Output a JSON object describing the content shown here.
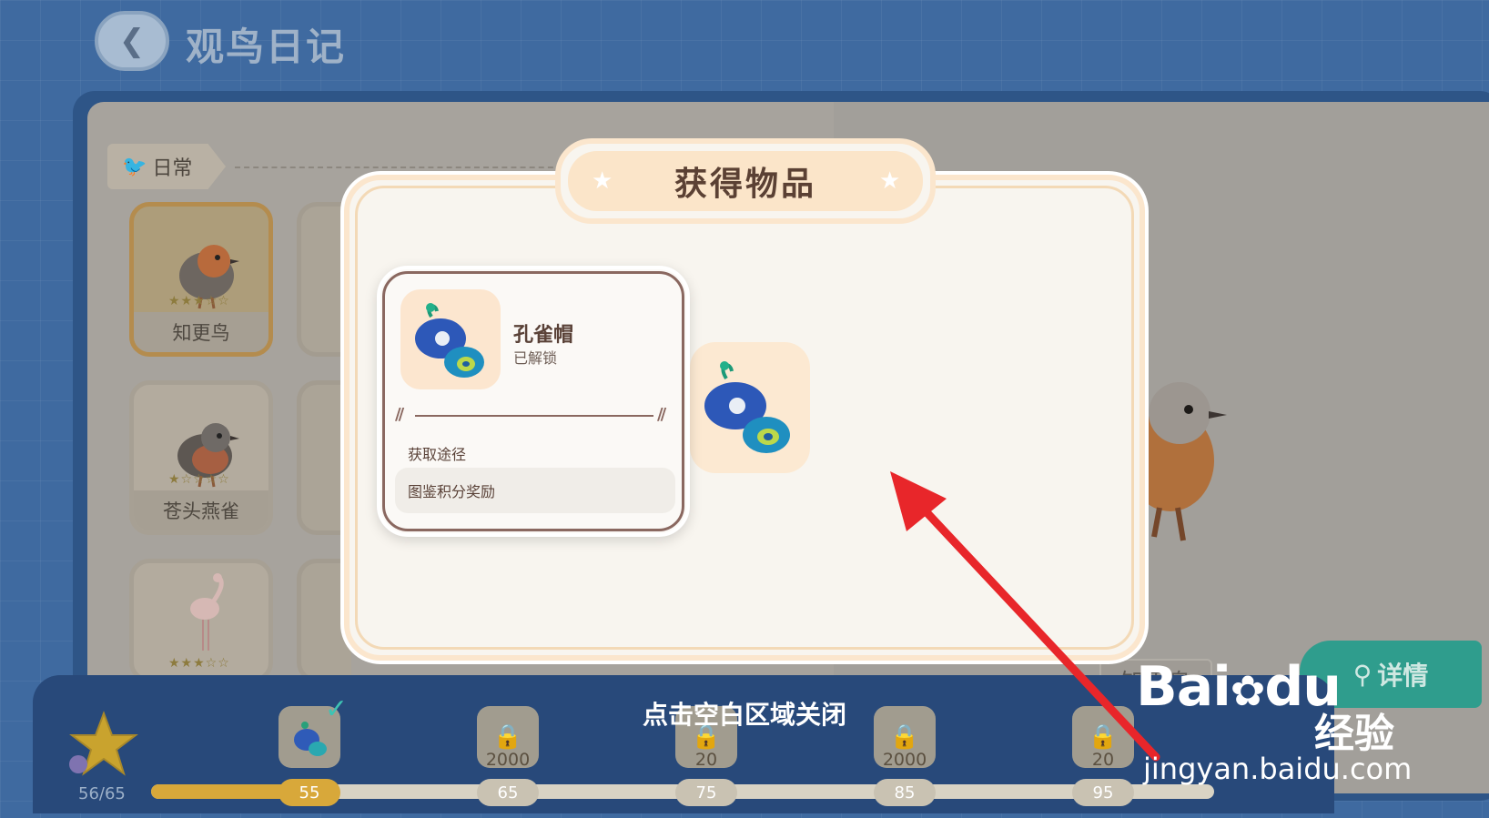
{
  "header": {
    "back_icon": "chevron-left-icon",
    "title": "观鸟日记"
  },
  "category": {
    "label": "日常",
    "icon": "bird-silhouette-icon"
  },
  "bird_cards": [
    {
      "name": "知更鸟",
      "stars": 3,
      "max_stars": 5,
      "selected": true
    },
    {
      "name": "苍头燕雀",
      "stars": 1,
      "max_stars": 5,
      "selected": false
    },
    {
      "name": "",
      "stars": 3,
      "max_stars": 5,
      "selected": false
    }
  ],
  "detail_panel": {
    "bird_label": "知更鸟",
    "detail_button": "详情",
    "detail_icon": "search-icon"
  },
  "modal": {
    "title": "获得物品",
    "item": {
      "name": "孔雀帽",
      "status": "已解锁",
      "source_label": "获取途径",
      "source_value": "图鉴积分奖励"
    }
  },
  "close_hint": "点击空白区域关闭",
  "progress": {
    "score": "56/65",
    "current": 56,
    "milestones": [
      {
        "threshold": "55",
        "reward": "",
        "locked": false,
        "claimed": true,
        "type": "peacock-hat"
      },
      {
        "threshold": "65",
        "reward": "2000",
        "locked": true,
        "claimed": false,
        "type": "coin"
      },
      {
        "threshold": "75",
        "reward": "20",
        "locked": true,
        "claimed": false,
        "type": "star-gem"
      },
      {
        "threshold": "85",
        "reward": "2000",
        "locked": true,
        "claimed": false,
        "type": "coin"
      },
      {
        "threshold": "95",
        "reward": "20",
        "locked": true,
        "claimed": false,
        "type": "star-gem"
      }
    ]
  },
  "watermark": {
    "brand": "Bai",
    "brand2": "du",
    "product": "经验",
    "url": "jingyan.baidu.com"
  },
  "colors": {
    "accent_gold": "#d8a83a",
    "modal_title_bg": "#fbe5c9",
    "annotation_red": "#e8262a",
    "detail_green": "#2f9d8d"
  }
}
